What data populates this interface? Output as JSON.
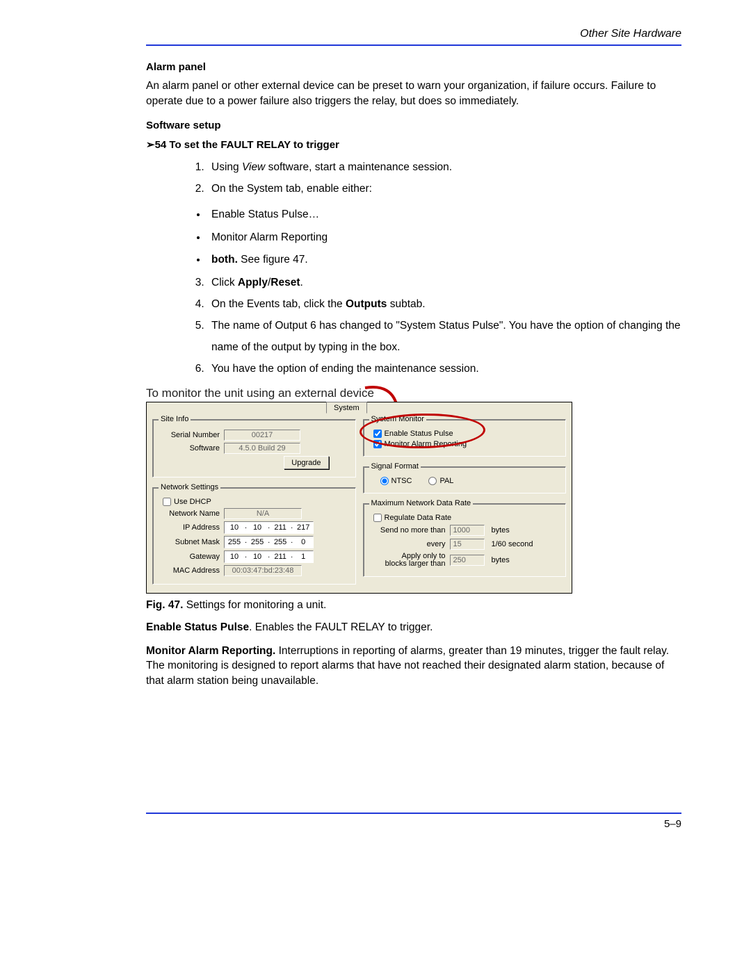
{
  "header": {
    "running": "Other Site Hardware"
  },
  "sections": {
    "alarm_head": "Alarm panel",
    "alarm_body": "An alarm panel or other external device can be preset to warn your organization, if failure occurs. Failure to operate due to a power failure also triggers the relay, but does so immediately.",
    "setup_head": "Software setup",
    "proc_head": "➢54 To set the FAULT RELAY to trigger"
  },
  "steps": {
    "s1_a": "Using ",
    "s1_i": "View",
    "s1_b": " software, start a maintenance session.",
    "s2": "On the System tab, enable either:",
    "b1": "Enable Status Pulse…",
    "b2": "Monitor Alarm Reporting",
    "b3_bold": "both.",
    "b3_tail": " See figure 47.",
    "s3_a": "Click ",
    "s3_b": "Apply",
    "s3_c": "/",
    "s3_d": "Reset",
    "s3_e": ".",
    "s4_a": "On the Events tab, click the ",
    "s4_b": "Outputs",
    "s4_c": " subtab.",
    "s5": "The name of Output 6 has changed to \"System Status Pulse\". You have the option of changing the name of the output by typing in the box.",
    "s6": "You have the option of ending the maintenance session."
  },
  "fig": {
    "overline": "To monitor the unit using an external device",
    "tab": "System",
    "site_info": {
      "legend": "Site Info",
      "serial_label": "Serial Number",
      "serial_value": "00217",
      "software_label": "Software",
      "software_value": "4.5.0 Build 29",
      "upgrade": "Upgrade"
    },
    "net": {
      "legend": "Network Settings",
      "use_dhcp": "Use DHCP",
      "name_label": "Network Name",
      "name_value": "N/A",
      "ip_label": "IP Address",
      "ip": [
        "10",
        "10",
        "211",
        "217"
      ],
      "mask_label": "Subnet Mask",
      "mask": [
        "255",
        "255",
        "255",
        "0"
      ],
      "gw_label": "Gateway",
      "gw": [
        "10",
        "10",
        "211",
        "1"
      ],
      "mac_label": "MAC Address",
      "mac_value": "00:03:47:bd:23:48"
    },
    "monitor": {
      "legend": "System Monitor",
      "pulse": "Enable Status Pulse",
      "alarm": "Monitor Alarm Reporting"
    },
    "signal": {
      "legend": "Signal Format",
      "ntsc": "NTSC",
      "pal": "PAL"
    },
    "rate": {
      "legend": "Maximum Network Data Rate",
      "regulate": "Regulate Data Rate",
      "send_label": "Send no more than",
      "send_value": "1000",
      "bytes1": "bytes",
      "every_label": "every",
      "every_value": "15",
      "every_unit": "1/60 second",
      "apply_label_a": "Apply only to",
      "apply_label_b": "blocks larger than",
      "apply_value": "250",
      "bytes2": "bytes"
    },
    "caption_lbl": "Fig. 47.",
    "caption_txt": "  Settings for monitoring a unit."
  },
  "post": {
    "esp_bold": "Enable Status Pulse",
    "esp_tail": ". Enables the FAULT RELAY to trigger.",
    "mar_bold": "Monitor Alarm Reporting.",
    "mar_tail": " Interruptions in reporting of alarms, greater than 19 minutes, trigger the fault relay. The monitoring is designed to report alarms that have not reached their designated alarm station, because of that alarm station being unavailable."
  },
  "footer": {
    "pageno": "5–9"
  }
}
